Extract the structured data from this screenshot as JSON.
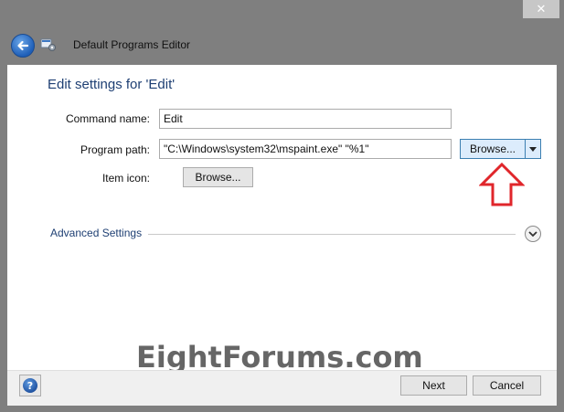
{
  "window": {
    "title": "Default Programs Editor",
    "close_glyph": "✕",
    "icons": {
      "back": "back-arrow-icon",
      "app": "app-icon",
      "close": "close-icon"
    }
  },
  "page": {
    "title": "Edit settings for 'Edit'"
  },
  "form": {
    "command_name": {
      "label": "Command name:",
      "value": "Edit"
    },
    "program_path": {
      "label": "Program path:",
      "value": "\"C:\\Windows\\system32\\mspaint.exe\" \"%1\"",
      "browse_label": "Browse..."
    },
    "item_icon": {
      "label": "Item icon:",
      "browse_label": "Browse..."
    }
  },
  "advanced": {
    "label": "Advanced Settings"
  },
  "watermark": "EightForums.com",
  "footer": {
    "next_label": "Next",
    "cancel_label": "Cancel",
    "help_glyph": "?"
  },
  "colors": {
    "accent_title": "#1e3f73",
    "annotation_arrow": "#e0262b",
    "titlebar": "#7f7f7f"
  }
}
